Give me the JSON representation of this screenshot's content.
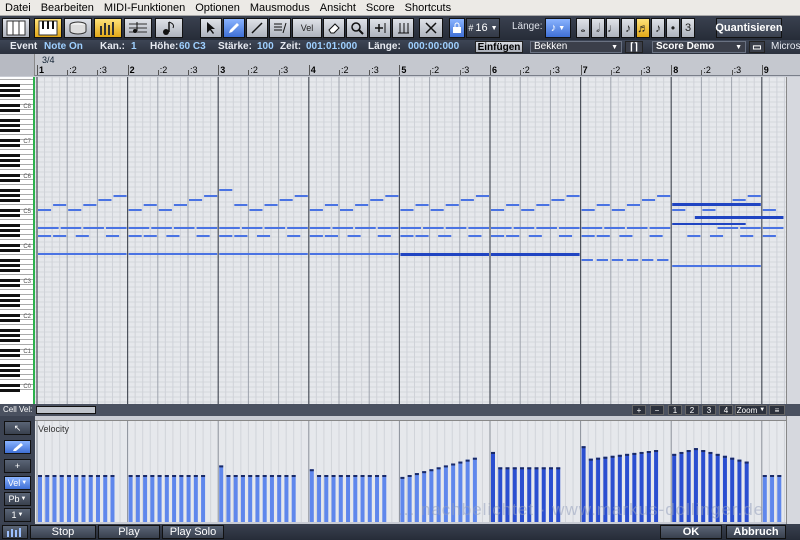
{
  "menu": [
    "Datei",
    "Bearbeiten",
    "MIDI-Funktionen",
    "Optionen",
    "Mausmodus",
    "Ansicht",
    "Score",
    "Shortcuts"
  ],
  "toolbar": {
    "vel_label": "Vel",
    "snap_value": "16",
    "laenge_label": "Länge:",
    "triplet_label": "3",
    "quantize_label": "Quantisieren"
  },
  "event": {
    "event_label": "Event",
    "type_value": "Note On",
    "kan_label": "Kan.:",
    "kan_value": "1",
    "hoehe_label": "Höhe:",
    "hoehe_value": "60 C3",
    "staerke_label": "Stärke:",
    "staerke_value": "100",
    "zeit_label": "Zeit:",
    "zeit_value": "001:01:000",
    "laenge_label": "Länge:",
    "laenge_value": "000:00:000",
    "insert_label": "Einfügen",
    "drum_value": "Bekken",
    "score_value": "Score Demo",
    "micros_label": "Micros"
  },
  "ruler": {
    "time_signature": "3/4",
    "bars": [
      "1",
      "2",
      "3",
      "4",
      "5",
      "6",
      "7",
      "8",
      "9"
    ],
    "beats": [
      ":2",
      ":3"
    ]
  },
  "keyboard": {
    "octave_labels": [
      "C8",
      "C7",
      "C6",
      "C5",
      "C4",
      "C3",
      "C2",
      "C1",
      "C0"
    ]
  },
  "scroll": {
    "cell_label": "Cell",
    "vel_label": "Vel:",
    "plus": "+",
    "minus": "−",
    "zoom_levels": [
      "1",
      "2",
      "3",
      "4"
    ],
    "zoom_label": "Zoom"
  },
  "controller": {
    "title": "Velocity",
    "vel_button": "Vel",
    "pb_button": "Pb",
    "channel_button": "1"
  },
  "watermark": "... nachbelichtet · www.markus-dollinger.de",
  "bottom": {
    "stop": "Stop",
    "play": "Play",
    "play_solo": "Play Solo",
    "ok": "OK",
    "cancel": "Abbruch"
  },
  "colors": {
    "note": "#4a73e3",
    "note_selected": "#1f44c2",
    "velocity_bar": "#5f87ec",
    "velocity_bar_selected": "#2b4fd0",
    "toolbar_active": "#f0c23c",
    "keyboard_edge": "#2bb24c"
  }
}
